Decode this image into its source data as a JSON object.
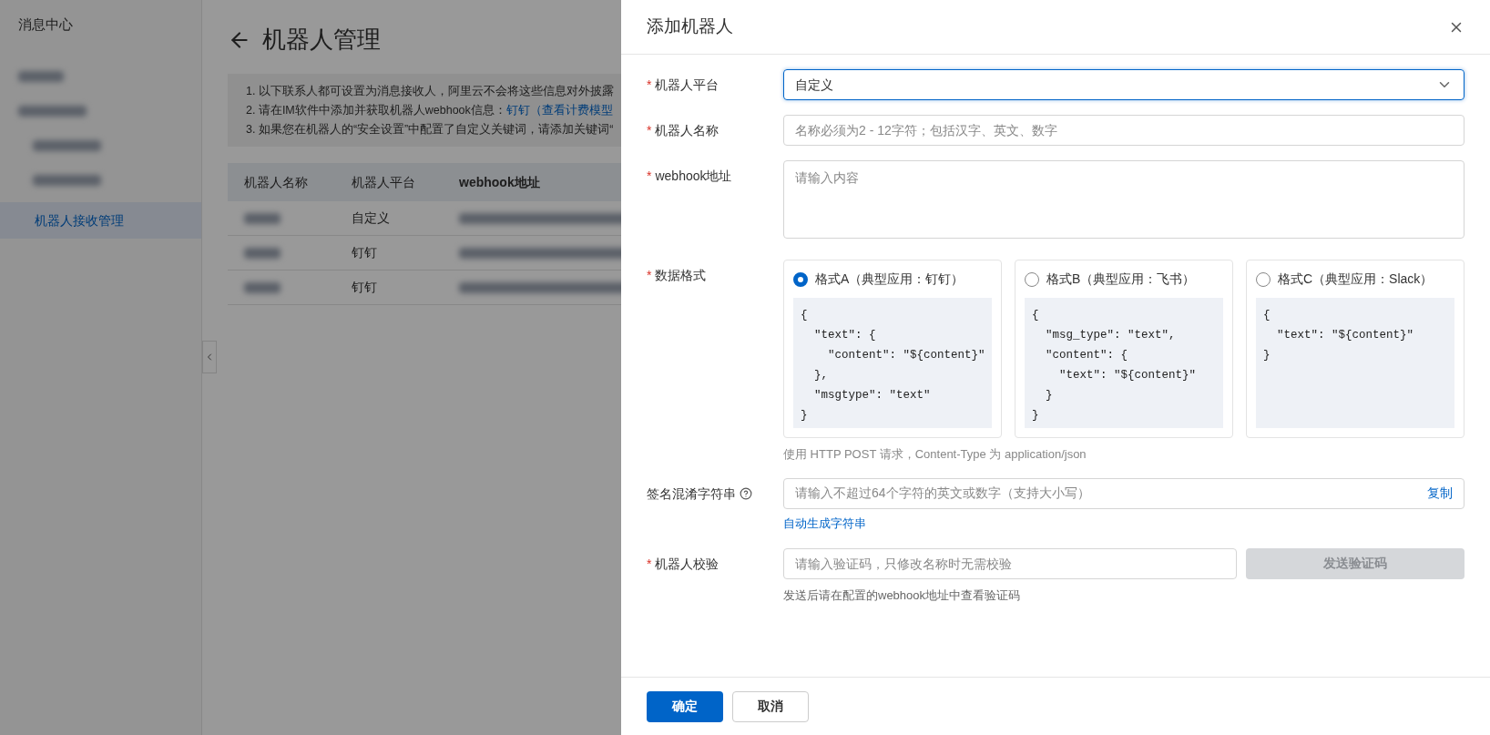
{
  "sidebar": {
    "title": "消息中心",
    "items": [
      {
        "label": "机器人接收管理",
        "selected": true
      }
    ]
  },
  "page": {
    "title": "机器人管理",
    "notice": [
      {
        "text": "1. 以下联系人都可设置为消息接收人，阿里云不会将这些信息对外披露"
      },
      {
        "text": "2. 请在IM软件中添加并获取机器人webhook信息：",
        "link": "钉钉（查看计费模型"
      },
      {
        "text": "3. 如果您在机器人的“安全设置”中配置了自定义关键词，请添加关键词“"
      }
    ],
    "table": {
      "columns": [
        "机器人名称",
        "机器人平台",
        "webhook地址"
      ],
      "rows": [
        {
          "platform": "自定义"
        },
        {
          "platform": "钉钉"
        },
        {
          "platform": "钉钉"
        }
      ]
    }
  },
  "drawer": {
    "title": "添加机器人",
    "fields": [
      {
        "kind": "select",
        "label": "机器人平台",
        "required_mark": "*",
        "value": "自定义"
      },
      {
        "kind": "input",
        "label": "机器人名称",
        "required_mark": "*",
        "placeholder": "名称必须为2 - 12字符；包括汉字、英文、数字"
      },
      {
        "kind": "textarea",
        "label": "webhook地址",
        "required_mark": "*",
        "placeholder": "请输入内容"
      },
      {
        "kind": "formats",
        "label": "数据格式",
        "required_mark": "*",
        "hint": "使用 HTTP POST 请求，Content-Type 为 application/json",
        "options": [
          {
            "label": "格式A（典型应用：钉钉）",
            "selected": true,
            "code": [
              "{",
              "  \"text\": {",
              "    \"content\": \"${content}\"",
              "  },",
              "  \"msgtype\": \"text\"",
              "}"
            ]
          },
          {
            "label": "格式B（典型应用：飞书）",
            "selected": false,
            "code": [
              "{",
              "  \"msg_type\": \"text\",",
              "  \"content\": {",
              "    \"text\": \"${content}\"",
              "  }",
              "}"
            ]
          },
          {
            "label": "格式C（典型应用：Slack）",
            "selected": false,
            "code": [
              "{",
              "  \"text\": \"${content}\"",
              "}"
            ]
          }
        ]
      },
      {
        "kind": "input_action",
        "label": "签名混淆字符串",
        "help": true,
        "placeholder": "请输入不超过64个字符的英文或数字（支持大小写）",
        "action": "复制",
        "link": "自动生成字符串"
      },
      {
        "kind": "input_button",
        "label": "机器人校验",
        "required_mark": "*",
        "placeholder": "请输入验证码，只修改名称时无需校验",
        "button": "发送验证码",
        "button_disabled": true,
        "hint": "发送后请在配置的webhook地址中查看验证码"
      }
    ],
    "buttons": [
      {
        "label": "确定",
        "primary": true
      },
      {
        "label": "取消",
        "primary": false
      }
    ]
  }
}
